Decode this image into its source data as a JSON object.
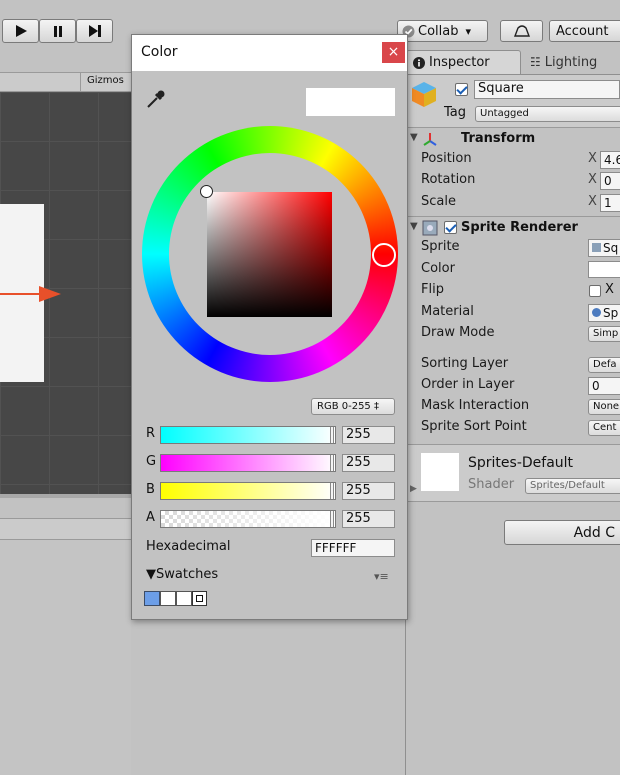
{
  "toolbar": {
    "collab_label": "Collab",
    "collab_arrow": "▾",
    "account_label": "Account",
    "play_icon": "play-icon",
    "pause_icon": "pause-icon",
    "step_icon": "step-icon"
  },
  "scene": {
    "gizmos_label": "Gizmos",
    "bg_color": "#474747",
    "arrow_color": "#e8502a"
  },
  "color_window": {
    "title": "Color",
    "close_label": "×",
    "close_color": "#d9464a",
    "preview_color": "#ffffff",
    "mode_label": "RGB 0-255 ‡",
    "channels": [
      {
        "label": "R",
        "value": "255"
      },
      {
        "label": "G",
        "value": "255"
      },
      {
        "label": "B",
        "value": "255"
      },
      {
        "label": "A",
        "value": "255"
      }
    ],
    "hex_label": "Hexadecimal",
    "hex_value": "FFFFFF",
    "swatches_label": "▼Swatches",
    "swatches_menu": "▾≡"
  },
  "inspector": {
    "tabs": [
      {
        "label": "Inspector"
      },
      {
        "label": "Lighting"
      }
    ],
    "object_name": "Square",
    "tag_label": "Tag",
    "tag_value": "Untagged",
    "transform": {
      "title": "Transform",
      "rows": [
        {
          "label": "Position",
          "axis": "X",
          "value": "4.6"
        },
        {
          "label": "Rotation",
          "axis": "X",
          "value": "0"
        },
        {
          "label": "Scale",
          "axis": "X",
          "value": "1"
        }
      ]
    },
    "sprite_renderer": {
      "title": "Sprite Renderer",
      "sprite_label": "Sprite",
      "sprite_value": "Sq",
      "color_label": "Color",
      "flip_label": "Flip",
      "flip_value": "X",
      "material_label": "Material",
      "material_value": "Sp",
      "draw_mode_label": "Draw Mode",
      "draw_mode_value": "Simp",
      "sorting_layer_label": "Sorting Layer",
      "sorting_layer_value": "Defa",
      "order_label": "Order in Layer",
      "order_value": "0",
      "mask_label": "Mask Interaction",
      "mask_value": "None",
      "sort_point_label": "Sprite Sort Point",
      "sort_point_value": "Cent"
    },
    "material": {
      "name": "Sprites-Default",
      "shader_label": "Shader",
      "shader_value": "Sprites/Default"
    },
    "add_component_label": "Add C"
  }
}
